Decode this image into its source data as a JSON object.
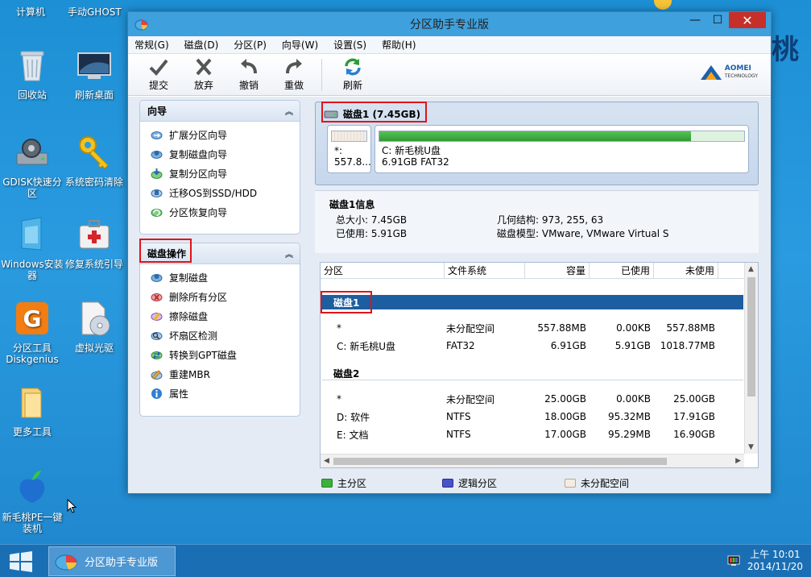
{
  "desktop": {
    "top_labels": [
      "计算机",
      "手动GHOST"
    ],
    "icons": [
      {
        "label": "回收站"
      },
      {
        "label": "刷新桌面"
      },
      {
        "label": "GDISK快速分区"
      },
      {
        "label": "系统密码清除"
      },
      {
        "label": "Windows安装器"
      },
      {
        "label": "修复系统引导"
      },
      {
        "label": "分区工具Diskgenius"
      },
      {
        "label": "虚拟光驱"
      },
      {
        "label": "更多工具"
      },
      {
        "label": "新毛桃PE一键装机"
      }
    ],
    "wallpaper_text": "桃"
  },
  "window": {
    "title": "分区助手专业版",
    "controls": {
      "minimize": "—",
      "maximize": "☐",
      "close": "✕"
    }
  },
  "menu": [
    "常规(G)",
    "磁盘(D)",
    "分区(P)",
    "向导(W)",
    "设置(S)",
    "帮助(H)"
  ],
  "toolbar": {
    "commit": "提交",
    "discard": "放弃",
    "undo": "撤销",
    "redo": "重做",
    "refresh": "刷新",
    "brand_name": "AOMEI",
    "brand_sub": "TECHNOLOGY"
  },
  "wizard_panel": {
    "title": "向导",
    "items": [
      "扩展分区向导",
      "复制磁盘向导",
      "复制分区向导",
      "迁移OS到SSD/HDD",
      "分区恢复向导"
    ]
  },
  "disk_ops_panel": {
    "title": "磁盘操作",
    "items": [
      "复制磁盘",
      "删除所有分区",
      "擦除磁盘",
      "坏扇区检测",
      "转换到GPT磁盘",
      "重建MBR",
      "属性"
    ]
  },
  "disk_map": {
    "title": "磁盘1 (7.45GB)",
    "unalloc": {
      "line1": "*:",
      "line2": "557.8..."
    },
    "partition": {
      "line1": "C:  新毛桃U盘",
      "line2": "6.91GB FAT32",
      "used_fraction": 0.855
    }
  },
  "disk_info": {
    "title": "磁盘1信息",
    "total_size": "总大小: 7.45GB",
    "used": "已使用: 5.91GB",
    "geometry": "几何结构: 973, 255, 63",
    "model": "磁盘模型: VMware, VMware Virtual S"
  },
  "table": {
    "headers": [
      "分区",
      "文件系统",
      "容量",
      "已使用",
      "未使用"
    ],
    "groups": [
      {
        "name": "磁盘1",
        "rows": [
          [
            "*",
            "未分配空间",
            "557.88MB",
            "0.00KB",
            "557.88MB"
          ],
          [
            "C: 新毛桃U盘",
            "FAT32",
            "6.91GB",
            "5.91GB",
            "1018.77MB"
          ]
        ]
      },
      {
        "name": "磁盘2",
        "rows": [
          [
            "*",
            "未分配空间",
            "25.00GB",
            "0.00KB",
            "25.00GB"
          ],
          [
            "D: 软件",
            "NTFS",
            "18.00GB",
            "95.32MB",
            "17.91GB"
          ],
          [
            "E: 文档",
            "NTFS",
            "17.00GB",
            "95.29MB",
            "16.90GB"
          ]
        ]
      }
    ]
  },
  "legend": [
    "主分区",
    "逻辑分区",
    "未分配空间"
  ],
  "colors": {
    "primary": "#3cb03c",
    "logical": "#4a52c8",
    "unallocated": "#f3ece4",
    "selected": "#1c5ea0",
    "highlight": "#e0141a"
  },
  "taskbar": {
    "task_label": "分区助手专业版",
    "time": "上午 10:01",
    "date": "2014/11/20"
  }
}
